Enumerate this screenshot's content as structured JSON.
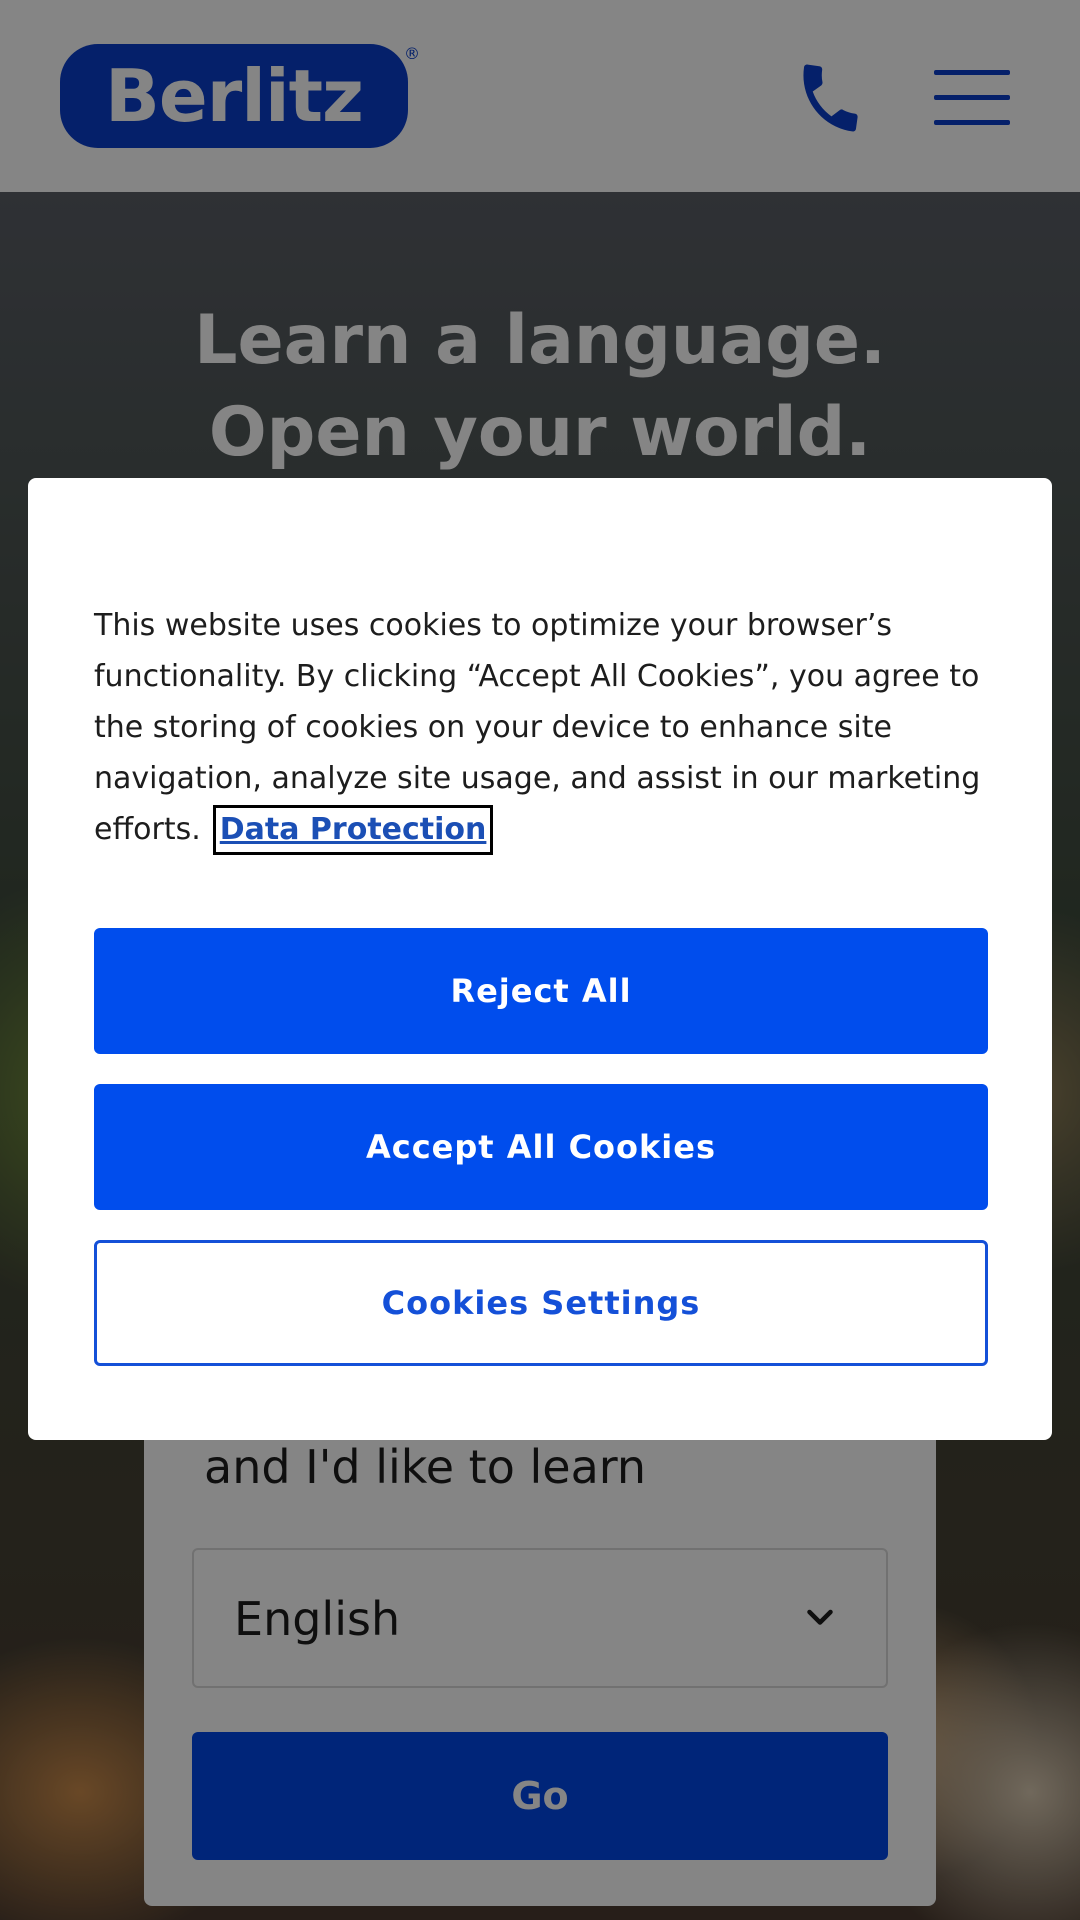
{
  "header": {
    "logo_text": "Berlitz",
    "logo_registered": "®",
    "phone_icon": "phone-icon",
    "menu_icon": "hamburger-menu-icon"
  },
  "hero": {
    "title": "Learn a language. Open your world."
  },
  "form": {
    "learn_label": "and I'd like to learn",
    "language_select_value": "English",
    "go_label": "Go"
  },
  "cookie_dialog": {
    "body_text": "This website uses cookies to optimize your browser’s functionality. By clicking “Accept All Cookies”, you agree to the storing of cookies on your device to enhance site navigation, analyze site usage, and assist in our marketing efforts.",
    "data_protection_link": "Data Protection",
    "reject_all_label": "Reject All",
    "accept_all_label": "Accept All Cookies",
    "settings_label": "Cookies Settings"
  },
  "colors": {
    "brand_blue": "#0a3ecc",
    "button_blue": "#004ded"
  }
}
